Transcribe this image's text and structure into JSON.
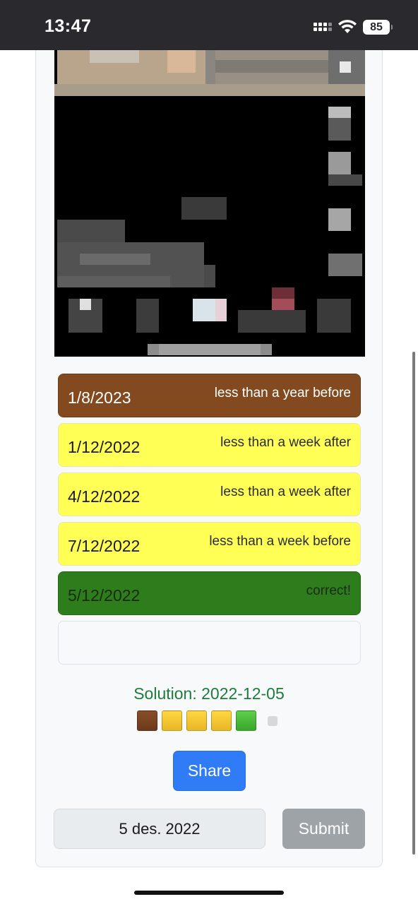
{
  "status_bar": {
    "time": "13:47",
    "battery": "85",
    "icons": [
      "signal-icon",
      "wifi-icon",
      "battery-icon"
    ]
  },
  "image": {
    "description_icon": "pixelated-photo"
  },
  "guesses": [
    {
      "date": "1/8/2023",
      "hint": "less than a year before",
      "status": "brown"
    },
    {
      "date": "1/12/2022",
      "hint": "less than a week after",
      "status": "yellow"
    },
    {
      "date": "4/12/2022",
      "hint": "less than a week after",
      "status": "yellow"
    },
    {
      "date": "7/12/2022",
      "hint": "less than a week before",
      "status": "yellow"
    },
    {
      "date": "5/12/2022",
      "hint": "correct!",
      "status": "green"
    }
  ],
  "solution": {
    "text": "Solution: 2022-12-05",
    "squares": [
      "brown",
      "yellow",
      "yellow",
      "yellow",
      "green",
      "blank"
    ]
  },
  "share_label": "Share",
  "date_input": {
    "value": "5 des. 2022"
  },
  "submit_label": "Submit",
  "colors": {
    "brown": "#834a1f",
    "yellow": "#ffff55",
    "green": "#2e7d1c",
    "share": "#2f7cf6",
    "submit_disabled": "#9ea3a8",
    "solution_text": "#1e7b3a"
  }
}
